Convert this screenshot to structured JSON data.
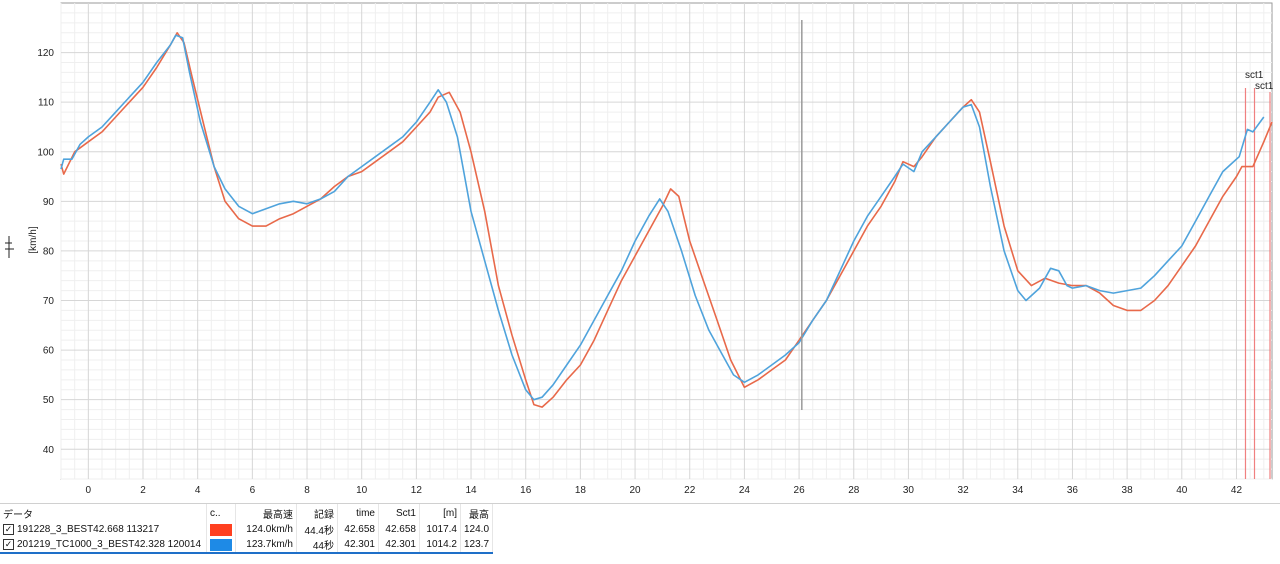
{
  "chart_data": {
    "type": "line",
    "xlim": [
      -1,
      43.3
    ],
    "ylim": [
      34,
      130
    ],
    "x_ticks": [
      "0",
      "2",
      "4",
      "6",
      "8",
      "10",
      "12",
      "14",
      "16",
      "18",
      "20",
      "22",
      "24",
      "26",
      "28",
      "30",
      "32",
      "34",
      "36",
      "38",
      "40",
      "42"
    ],
    "y_ticks": [
      "40",
      "50",
      "60",
      "70",
      "80",
      "90",
      "100",
      "110",
      "120"
    ],
    "ylabel": "[km/h]",
    "cursor_x": 26.1,
    "sector_label": "sct1",
    "grid": true,
    "series": [
      {
        "name": "191228_3_BEST42.668  113217",
        "color": "#e8694a",
        "sector_x": 42.66,
        "points": [
          [
            -1.6,
            97.5
          ],
          [
            -0.9,
            95.5
          ],
          [
            -0.5,
            100
          ],
          [
            0,
            102
          ],
          [
            0.5,
            104
          ],
          [
            1,
            107
          ],
          [
            1.5,
            110
          ],
          [
            2,
            113
          ],
          [
            2.5,
            117
          ],
          [
            3,
            121.5
          ],
          [
            3.25,
            124
          ],
          [
            3.5,
            122
          ],
          [
            3.8,
            115
          ],
          [
            4.2,
            106
          ],
          [
            4.6,
            97
          ],
          [
            5,
            90
          ],
          [
            5.5,
            86.5
          ],
          [
            6,
            85
          ],
          [
            6.5,
            85
          ],
          [
            7,
            86.5
          ],
          [
            7.5,
            87.5
          ],
          [
            8,
            89
          ],
          [
            8.5,
            90.5
          ],
          [
            9,
            93
          ],
          [
            9.5,
            95
          ],
          [
            10,
            96
          ],
          [
            10.5,
            98
          ],
          [
            11,
            100
          ],
          [
            11.5,
            102
          ],
          [
            12,
            105
          ],
          [
            12.5,
            108
          ],
          [
            12.8,
            111
          ],
          [
            13.2,
            112
          ],
          [
            13.6,
            108
          ],
          [
            14,
            100
          ],
          [
            14.5,
            88
          ],
          [
            15,
            73
          ],
          [
            15.5,
            63
          ],
          [
            16,
            54
          ],
          [
            16.3,
            49
          ],
          [
            16.6,
            48.5
          ],
          [
            17,
            50.5
          ],
          [
            17.5,
            54
          ],
          [
            18,
            57
          ],
          [
            18.5,
            62
          ],
          [
            19,
            68
          ],
          [
            19.5,
            74
          ],
          [
            20,
            79
          ],
          [
            20.5,
            84
          ],
          [
            21,
            89
          ],
          [
            21.3,
            92.5
          ],
          [
            21.6,
            91
          ],
          [
            22,
            82
          ],
          [
            22.5,
            74
          ],
          [
            23,
            66
          ],
          [
            23.5,
            58
          ],
          [
            24,
            52.5
          ],
          [
            24.5,
            54
          ],
          [
            25,
            56
          ],
          [
            25.5,
            58
          ],
          [
            26,
            62
          ],
          [
            26.5,
            66
          ],
          [
            27,
            70
          ],
          [
            27.5,
            75
          ],
          [
            28,
            80
          ],
          [
            28.5,
            85
          ],
          [
            29,
            89
          ],
          [
            29.5,
            94
          ],
          [
            29.8,
            98
          ],
          [
            30.2,
            97
          ],
          [
            30.5,
            99
          ],
          [
            31,
            103
          ],
          [
            31.5,
            106
          ],
          [
            32,
            109
          ],
          [
            32.3,
            110.5
          ],
          [
            32.6,
            108
          ],
          [
            33,
            98
          ],
          [
            33.5,
            85
          ],
          [
            34,
            76
          ],
          [
            34.5,
            73
          ],
          [
            35,
            74.5
          ],
          [
            35.5,
            73.5
          ],
          [
            36,
            73
          ],
          [
            36.5,
            73
          ],
          [
            37,
            71.5
          ],
          [
            37.5,
            69
          ],
          [
            38,
            68
          ],
          [
            38.5,
            68
          ],
          [
            39,
            70
          ],
          [
            39.5,
            73
          ],
          [
            40,
            77
          ],
          [
            40.5,
            81
          ],
          [
            41,
            86
          ],
          [
            41.5,
            91
          ],
          [
            42,
            95
          ],
          [
            42.2,
            97
          ],
          [
            42.6,
            97
          ],
          [
            43,
            102
          ],
          [
            43.3,
            106
          ]
        ]
      },
      {
        "name": "201219_TC1000_3_BEST42.328  120014",
        "color": "#4fa3dc",
        "sector_x": 42.33,
        "points": [
          [
            -1.6,
            96.5
          ],
          [
            -0.9,
            98.5
          ],
          [
            -0.6,
            98.5
          ],
          [
            -0.3,
            101.5
          ],
          [
            0,
            103
          ],
          [
            0.5,
            105
          ],
          [
            1,
            108
          ],
          [
            1.5,
            111
          ],
          [
            2,
            114
          ],
          [
            2.5,
            118
          ],
          [
            3,
            121.5
          ],
          [
            3.2,
            123.5
          ],
          [
            3.45,
            123
          ],
          [
            3.7,
            116
          ],
          [
            4.1,
            106
          ],
          [
            4.6,
            97
          ],
          [
            5,
            92.5
          ],
          [
            5.5,
            89
          ],
          [
            6,
            87.5
          ],
          [
            6.5,
            88.5
          ],
          [
            7,
            89.5
          ],
          [
            7.5,
            90
          ],
          [
            8,
            89.5
          ],
          [
            8.5,
            90.5
          ],
          [
            9,
            92
          ],
          [
            9.5,
            95
          ],
          [
            10,
            97
          ],
          [
            10.5,
            99
          ],
          [
            11,
            101
          ],
          [
            11.5,
            103
          ],
          [
            12,
            106
          ],
          [
            12.5,
            110
          ],
          [
            12.8,
            112.5
          ],
          [
            13.1,
            110
          ],
          [
            13.5,
            103
          ],
          [
            14,
            88
          ],
          [
            14.5,
            78
          ],
          [
            15,
            68
          ],
          [
            15.5,
            59
          ],
          [
            16,
            52
          ],
          [
            16.3,
            50
          ],
          [
            16.6,
            50.5
          ],
          [
            17,
            53
          ],
          [
            17.5,
            57
          ],
          [
            18,
            61
          ],
          [
            18.5,
            66
          ],
          [
            19,
            71
          ],
          [
            19.5,
            76
          ],
          [
            20,
            82
          ],
          [
            20.5,
            87
          ],
          [
            20.9,
            90.5
          ],
          [
            21.2,
            88
          ],
          [
            21.7,
            80
          ],
          [
            22.2,
            71
          ],
          [
            22.7,
            64
          ],
          [
            23.2,
            59
          ],
          [
            23.6,
            55
          ],
          [
            24,
            53.5
          ],
          [
            24.5,
            55
          ],
          [
            25,
            57
          ],
          [
            25.5,
            59
          ],
          [
            26,
            61.5
          ],
          [
            26.5,
            66
          ],
          [
            27,
            70
          ],
          [
            27.5,
            76
          ],
          [
            28,
            82
          ],
          [
            28.5,
            87
          ],
          [
            29,
            91
          ],
          [
            29.5,
            95
          ],
          [
            29.8,
            97.5
          ],
          [
            30.2,
            96
          ],
          [
            30.5,
            100
          ],
          [
            31,
            103
          ],
          [
            31.5,
            106
          ],
          [
            32,
            109
          ],
          [
            32.3,
            109.5
          ],
          [
            32.6,
            105
          ],
          [
            33,
            93
          ],
          [
            33.5,
            80
          ],
          [
            34,
            72
          ],
          [
            34.3,
            70
          ],
          [
            34.8,
            72.5
          ],
          [
            35.2,
            76.5
          ],
          [
            35.5,
            76
          ],
          [
            35.8,
            73
          ],
          [
            36,
            72.5
          ],
          [
            36.5,
            73
          ],
          [
            37,
            72
          ],
          [
            37.5,
            71.5
          ],
          [
            38,
            72
          ],
          [
            38.5,
            72.5
          ],
          [
            39,
            75
          ],
          [
            39.5,
            78
          ],
          [
            40,
            81
          ],
          [
            40.5,
            86
          ],
          [
            41,
            91
          ],
          [
            41.5,
            96
          ],
          [
            41.8,
            97.5
          ],
          [
            42.1,
            99
          ],
          [
            42.4,
            104.5
          ],
          [
            42.6,
            104
          ],
          [
            43,
            107
          ]
        ]
      }
    ]
  },
  "legend": {
    "headers": [
      "データ",
      "c..",
      "最高速",
      "記録",
      "time",
      "Sct1",
      "[m]",
      "最高"
    ],
    "rows": [
      {
        "name": "191228_3_BEST42.668  113217",
        "color": "#ff4020",
        "top_speed": "124.0km/h",
        "record": "44.4秒",
        "time": "42.658",
        "sct1": "42.658",
        "m": "1017.4",
        "max": "124.0"
      },
      {
        "name": "201219_TC1000_3_BEST42.328  120014",
        "color": "#1e8ae6",
        "top_speed": "123.7km/h",
        "record": "44秒",
        "time": "42.301",
        "sct1": "42.301",
        "m": "1014.2",
        "max": "123.7"
      }
    ]
  }
}
